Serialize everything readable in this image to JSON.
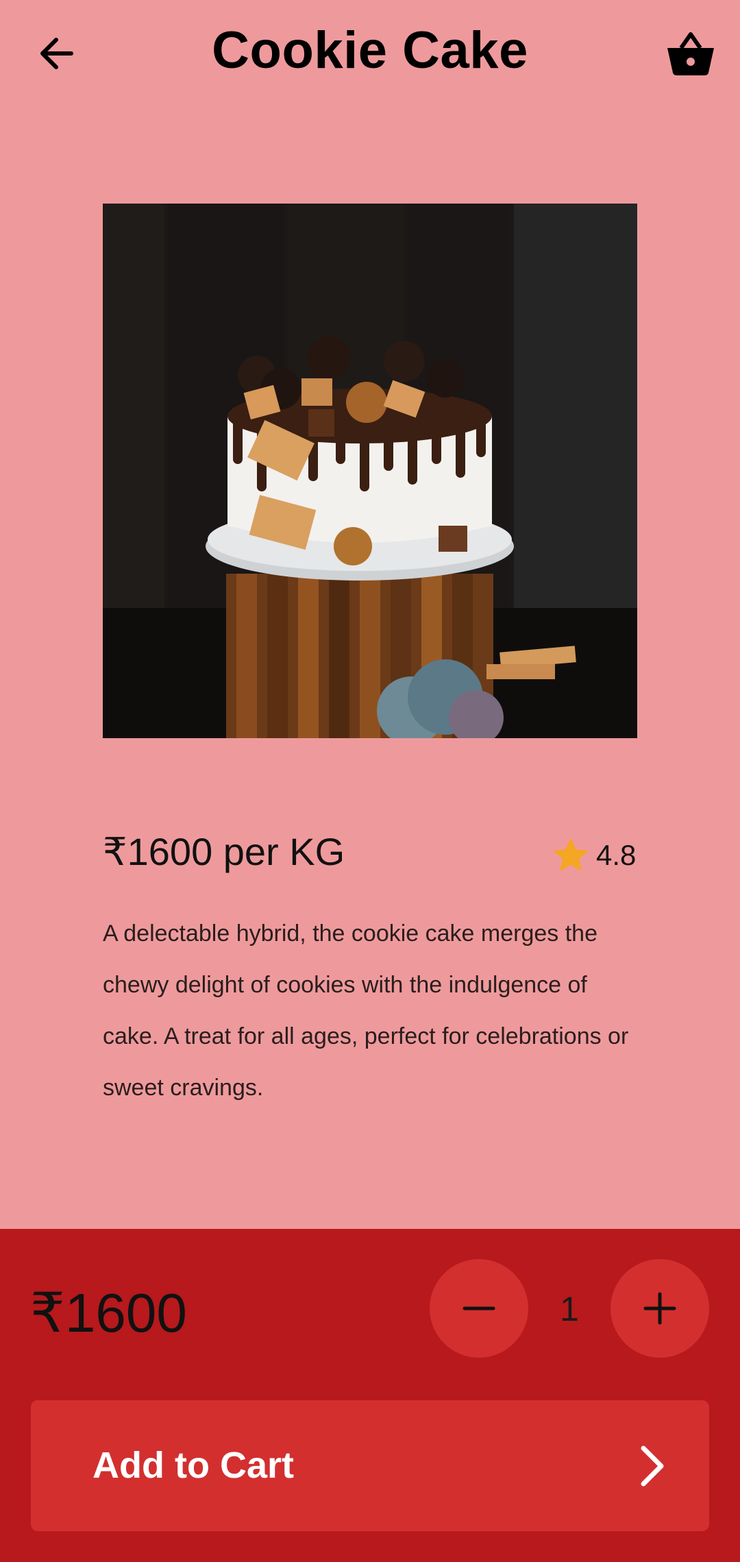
{
  "header": {
    "title": "Cookie Cake",
    "back_icon": "arrow-left-icon",
    "cart_icon": "shopping-basket-icon"
  },
  "product": {
    "image_alt": "Cookie cake",
    "price_per_unit": "₹1600 per KG",
    "rating": "4.8",
    "description": "A delectable hybrid, the cookie cake merges the chewy delight of cookies with the indulgence of cake. A treat for all ages, perfect for celebrations or sweet cravings."
  },
  "order": {
    "total": "₹1600",
    "quantity": "1",
    "add_to_cart_label": "Add to Cart"
  },
  "colors": {
    "background": "#ee9a9c",
    "panel": "#b7191c",
    "button": "#d32f2f",
    "star": "#f5a623"
  }
}
